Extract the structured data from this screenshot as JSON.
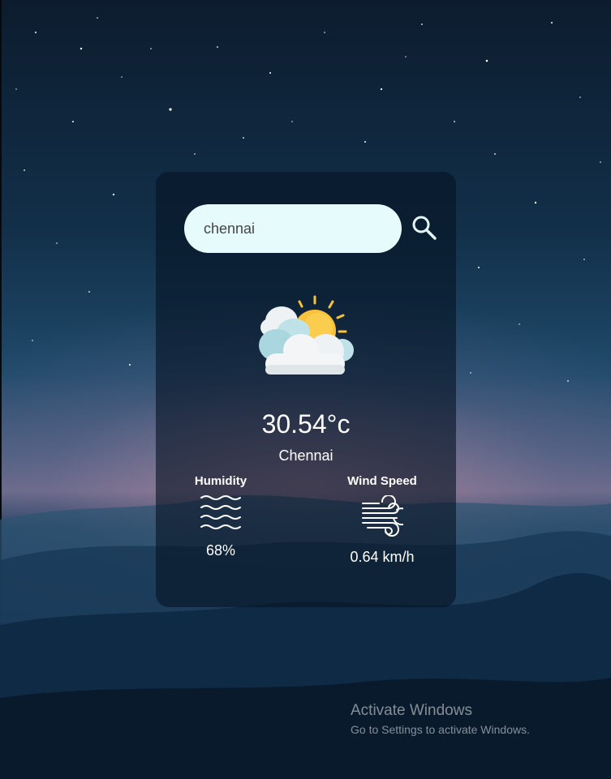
{
  "search": {
    "value": "chennai",
    "placeholder": "",
    "button_icon": "search-icon"
  },
  "weather": {
    "icon": "partly-cloudy-icon",
    "temperature": "30.54°c",
    "city": "Chennai"
  },
  "humidity": {
    "label": "Humidity",
    "icon": "humidity-waves-icon",
    "value": "68%"
  },
  "wind": {
    "label": "Wind Speed",
    "icon": "wind-icon",
    "value": "0.64 km/h"
  },
  "watermark": {
    "title": "Activate Windows",
    "subtitle": "Go to Settings to activate Windows."
  },
  "colors": {
    "input_bg": "#e6fbfb",
    "card_bg": "rgba(6,20,36,0.62)",
    "sun": "#f9c23c"
  }
}
